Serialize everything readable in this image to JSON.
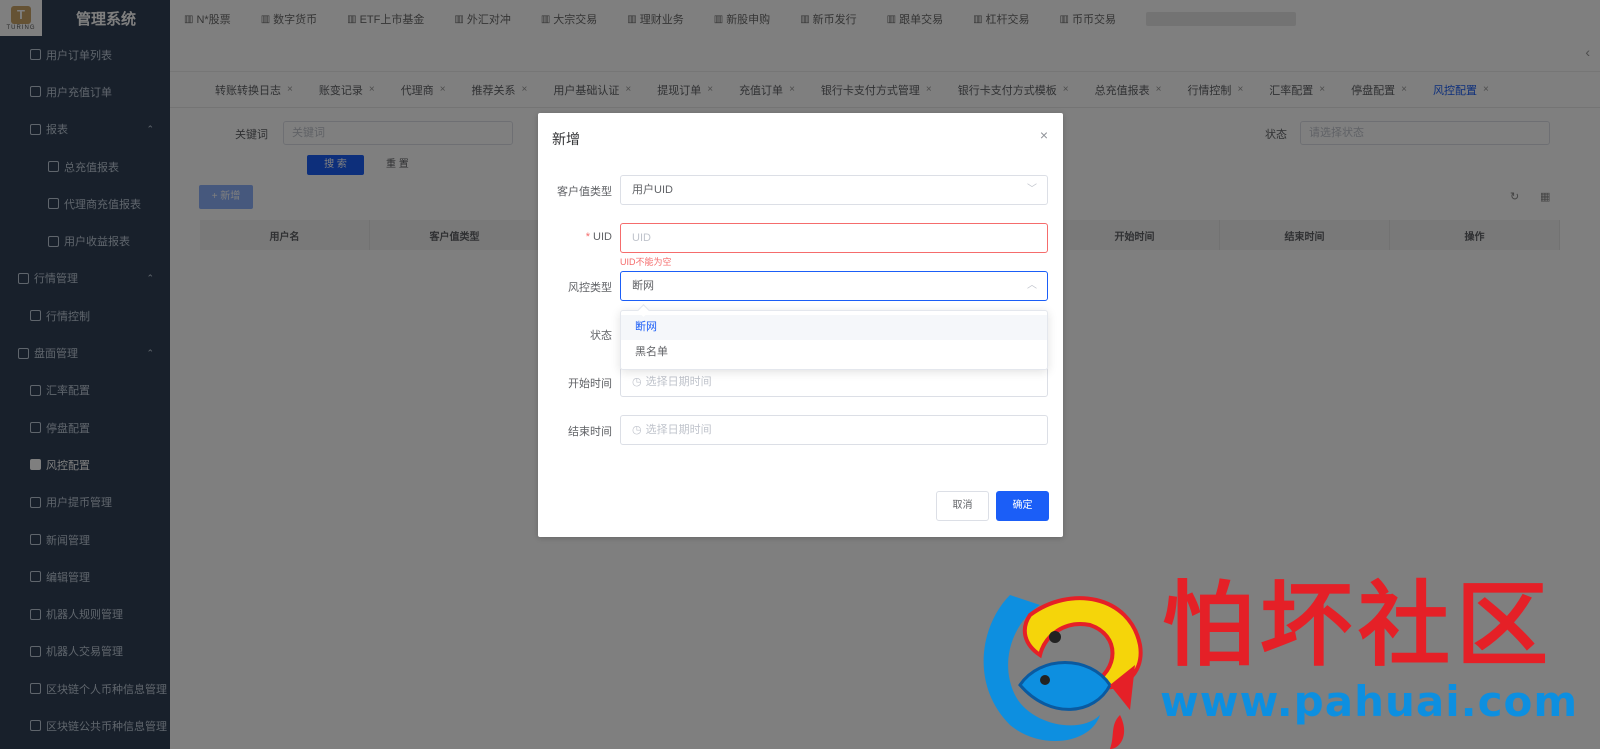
{
  "app": {
    "brand": "管理系统",
    "logo_text": "TURING",
    "logo_char": "T"
  },
  "sidebar": {
    "items": [
      {
        "label": "用户订单列表",
        "level": 2
      },
      {
        "label": "用户充值订单",
        "level": 2
      },
      {
        "label": "报表",
        "level": 2,
        "arrow": "⌃"
      },
      {
        "label": "总充值报表",
        "level": 3
      },
      {
        "label": "代理商充值报表",
        "level": 3
      },
      {
        "label": "用户收益报表",
        "level": 3
      },
      {
        "label": "行情管理",
        "level": 1,
        "arrow": "⌃"
      },
      {
        "label": "行情控制",
        "level": 2
      },
      {
        "label": "盘面管理",
        "level": 1,
        "arrow": "⌃"
      },
      {
        "label": "汇率配置",
        "level": 2
      },
      {
        "label": "停盘配置",
        "level": 2
      },
      {
        "label": "风控配置",
        "level": 2,
        "active": true
      },
      {
        "label": "用户提币管理",
        "level": 2
      },
      {
        "label": "新闻管理",
        "level": 2
      },
      {
        "label": "编辑管理",
        "level": 2
      },
      {
        "label": "机器人规则管理",
        "level": 2
      },
      {
        "label": "机器人交易管理",
        "level": 2
      },
      {
        "label": "区块链个人币种信息管理",
        "level": 2
      },
      {
        "label": "区块链公共币种信息管理",
        "level": 2
      }
    ]
  },
  "topnav": {
    "items": [
      "N*股票",
      "数字货币",
      "ETF上市基金",
      "外汇对冲",
      "大宗交易",
      "理财业务",
      "新股申购",
      "新币发行",
      "跟单交易",
      "杠杆交易",
      "币币交易"
    ]
  },
  "tabs": {
    "items": [
      {
        "label": "转账转换日志"
      },
      {
        "label": "账变记录"
      },
      {
        "label": "代理商"
      },
      {
        "label": "推荐关系"
      },
      {
        "label": "用户基础认证"
      },
      {
        "label": "提现订单"
      },
      {
        "label": "充值订单"
      },
      {
        "label": "银行卡支付方式管理"
      },
      {
        "label": "银行卡支付方式模板"
      },
      {
        "label": "总充值报表"
      },
      {
        "label": "行情控制"
      },
      {
        "label": "汇率配置"
      },
      {
        "label": "停盘配置"
      },
      {
        "label": "风控配置",
        "active": true
      }
    ],
    "close_glyph": "×"
  },
  "filter": {
    "keyword_label": "关键词",
    "keyword_placeholder": "关键词",
    "status_label": "状态",
    "status_placeholder": "请选择状态",
    "search_label": "搜 索",
    "reset_label": "重 置",
    "add_label": "+ 新增"
  },
  "table": {
    "columns": [
      "用户名",
      "客户值类型",
      "",
      "",
      "",
      "开始时间",
      "结束时间",
      "操作"
    ]
  },
  "dialog": {
    "title": "新增",
    "close": "×",
    "fields": {
      "customer_type": {
        "label": "客户值类型",
        "value": "用户UID"
      },
      "uid": {
        "label": "UID",
        "required_mark": "*",
        "placeholder": "UID",
        "error": "UID不能为空"
      },
      "risk_type": {
        "label": "风控类型",
        "value": "断网"
      },
      "status": {
        "label": "状态"
      },
      "start_time": {
        "label": "开始时间",
        "placeholder": "选择日期时间"
      },
      "end_time": {
        "label": "结束时间",
        "placeholder": "选择日期时间"
      }
    },
    "dropdown_options": [
      {
        "label": "断网",
        "selected": true
      },
      {
        "label": "黑名单",
        "selected": false
      }
    ],
    "cancel_label": "取消",
    "confirm_label": "确定"
  },
  "watermark": {
    "title": "怕坏社区",
    "url": "www.pahuai.com"
  },
  "colors": {
    "primary": "#1b5ef7",
    "error": "#f56c6c",
    "sidebar_bg": "#304156",
    "watermark_red": "#e52027",
    "watermark_blue": "#0d8fe0"
  }
}
